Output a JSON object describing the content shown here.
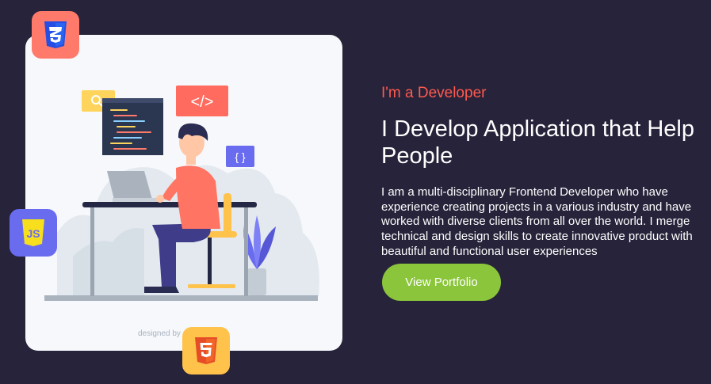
{
  "illustration": {
    "credit": "designed by"
  },
  "badges": {
    "css": "CSS3 logo",
    "js": "JS logo",
    "html": "HTML5 logo"
  },
  "hero": {
    "subtitle": "I'm a Developer",
    "title": "I Develop Application that Help People",
    "description": "I am a multi-disciplinary Frontend Developer who have experience creating projects in a various industry and have worked with diverse clients from all over the world. I merge technical and design skills to create innovative product with beautiful and functional user experiences",
    "cta_label": "View Portfolio"
  },
  "colors": {
    "background": "#27233a",
    "accent": "#ff5a4e",
    "button": "#8ac53b",
    "card": "#f6f8fb"
  }
}
